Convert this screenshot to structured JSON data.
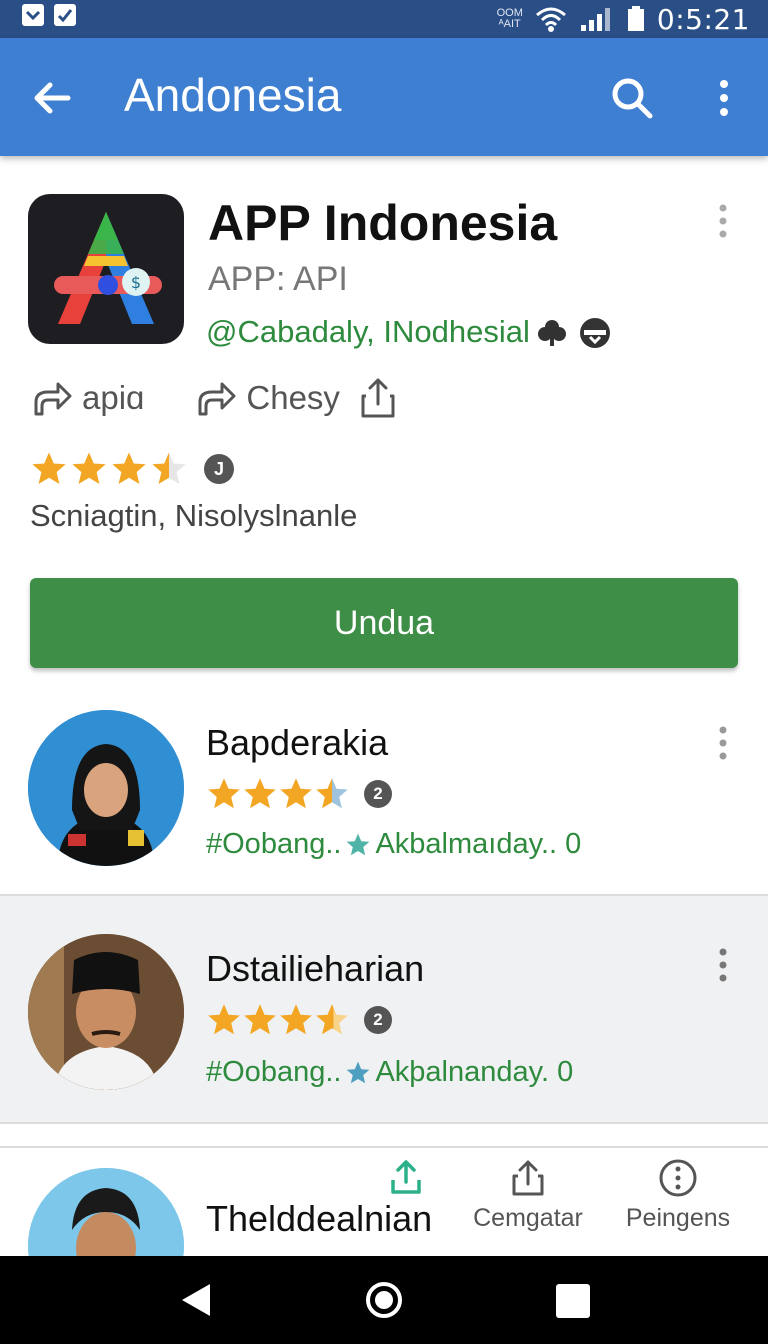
{
  "status_bar": {
    "network_top": "OOM",
    "network_bottom": "ᴬAIT",
    "time": "0:5:21"
  },
  "toolbar": {
    "title": "Andonesia",
    "back_icon": "arrow-back-icon",
    "search_icon": "search-icon",
    "more_icon": "more-vert-icon"
  },
  "app": {
    "title": "APP Indonesia",
    "subtitle": "APP: API",
    "developer": "@Cabadaly, INodhesial",
    "actions": [
      {
        "label": "apiɑ",
        "icon": "share-arrow-icon"
      },
      {
        "label": "Chesy",
        "icon": "share-arrow-icon"
      }
    ],
    "rating": 3.5,
    "info_badge": "J",
    "category": "Scniagtin, Nisolyslnanle",
    "install_label": "Undua"
  },
  "list": [
    {
      "name": "Bapderakia",
      "rating": 3.5,
      "badge": "2",
      "meta_left": "#Oobang..",
      "meta_right": "Akbalmaıday.. 0"
    },
    {
      "name": "Dstailieharian",
      "rating": 3.5,
      "badge": "2",
      "meta_left": "#Oobang..",
      "meta_right": "Akþalnanday. 0"
    },
    {
      "name": "Thelddealnian"
    }
  ],
  "bottom_actions": [
    {
      "label": "",
      "icon": "upload-icon"
    },
    {
      "label": "Cemgatar",
      "icon": "share-icon"
    },
    {
      "label": "Peingens",
      "icon": "more-circle-icon"
    }
  ],
  "colors": {
    "status_bar": "#2a4f86",
    "toolbar": "#3f7fd1",
    "install_button": "#3e8e47",
    "developer_text": "#2e8b3e",
    "star": "#f3a623"
  }
}
